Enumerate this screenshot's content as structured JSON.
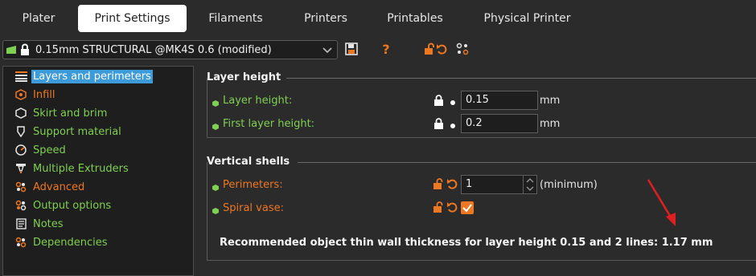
{
  "tabs": [
    {
      "label": "Plater"
    },
    {
      "label": "Print Settings"
    },
    {
      "label": "Filaments"
    },
    {
      "label": "Printers"
    },
    {
      "label": "Printables"
    },
    {
      "label": "Physical Printer"
    }
  ],
  "active_tab_index": 1,
  "preset": {
    "value": "0.15mm STRUCTURAL @MK4S 0.6 (modified)",
    "icons": [
      "printer-compat-icon",
      "lock-icon",
      "chevron-down-icon",
      "save-icon",
      "help-icon",
      "unlock-icon",
      "undo-icon",
      "compare-icon"
    ]
  },
  "sidebar": {
    "items": [
      {
        "label": "Layers and perimeters",
        "icon": "layers-icon",
        "color": "white",
        "selected": true
      },
      {
        "label": "Infill",
        "icon": "infill-icon",
        "color": "orange"
      },
      {
        "label": "Skirt and brim",
        "icon": "skirt-icon",
        "color": "green"
      },
      {
        "label": "Support material",
        "icon": "support-icon",
        "color": "green"
      },
      {
        "label": "Speed",
        "icon": "speed-icon",
        "color": "green"
      },
      {
        "label": "Multiple Extruders",
        "icon": "extruder-icon",
        "color": "green"
      },
      {
        "label": "Advanced",
        "icon": "advanced-icon",
        "color": "orange"
      },
      {
        "label": "Output options",
        "icon": "output-icon",
        "color": "green"
      },
      {
        "label": "Notes",
        "icon": "notes-icon",
        "color": "green"
      },
      {
        "label": "Dependencies",
        "icon": "dependencies-icon",
        "color": "green"
      }
    ]
  },
  "groups": {
    "layer_height": {
      "title": "Layer height",
      "options": [
        {
          "label": "Layer height:",
          "value": "0.15",
          "unit": "mm"
        },
        {
          "label": "First layer height:",
          "value": "0.2",
          "unit": "mm"
        }
      ]
    },
    "vertical_shells": {
      "title": "Vertical shells",
      "perimeters": {
        "label": "Perimeters:",
        "value": "1",
        "unit": "(minimum)"
      },
      "spiral_vase": {
        "label": "Spiral vase:",
        "checked": true
      },
      "note": "Recommended object thin wall thickness for layer height 0.15 and 2 lines: 1.17 mm"
    }
  },
  "colors": {
    "accent_orange": "#ee7722",
    "system_green": "#7fcf52",
    "selection_blue": "#3c9bd8",
    "arrow_red": "#e02020"
  }
}
